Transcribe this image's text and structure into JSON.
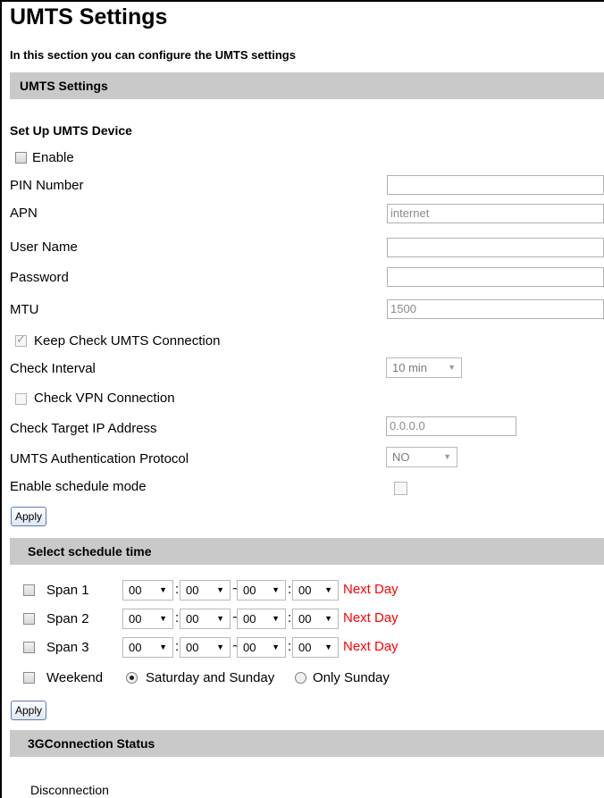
{
  "page": {
    "title": "UMTS Settings",
    "subtitle": "In this section you can configure the UMTS settings"
  },
  "umts_section": {
    "header": "UMTS Settings",
    "setup_label": "Set Up UMTS Device",
    "enable_label": "Enable",
    "enable_checked": false,
    "pin_label": "PIN Number",
    "pin_value": "",
    "apn_label": "APN",
    "apn_value": "internet",
    "username_label": "User Name",
    "username_value": "",
    "password_label": "Password",
    "password_value": "",
    "mtu_label": "MTU",
    "mtu_value": "1500",
    "keep_check_label": "Keep Check UMTS Connection",
    "keep_check_checked": true,
    "check_interval_label": "Check Interval",
    "check_interval_value": "10 min",
    "check_vpn_label": "Check VPN Connection",
    "check_vpn_checked": false,
    "target_ip_label": "Check Target IP Address",
    "target_ip_value": "0.0.0.0",
    "auth_protocol_label": "UMTS Authentication Protocol",
    "auth_protocol_value": "NO",
    "schedule_mode_label": "Enable schedule mode",
    "schedule_mode_checked": false,
    "apply_label": "Apply"
  },
  "schedule_section": {
    "header": "Select schedule time",
    "spans": [
      {
        "label": "Span 1",
        "start_hour": "00",
        "start_min": "00",
        "end_hour": "00",
        "end_min": "00",
        "next_day": "Next Day"
      },
      {
        "label": "Span 2",
        "start_hour": "00",
        "start_min": "00",
        "end_hour": "00",
        "end_min": "00",
        "next_day": "Next Day"
      },
      {
        "label": "Span 3",
        "start_hour": "00",
        "start_min": "00",
        "end_hour": "00",
        "end_min": "00",
        "next_day": "Next Day"
      }
    ],
    "separator_colon": ":",
    "separator_tilde": "~",
    "weekend_label": "Weekend",
    "radio_saturday_sunday": "Saturday and Sunday",
    "radio_only_sunday": "Only Sunday",
    "selected_weekend": "Saturday and Sunday",
    "apply_label": "Apply"
  },
  "status_section": {
    "header": "3GConnection Status",
    "status_text": "Disconnection"
  },
  "icons": {
    "dropdown_arrow": "▼"
  }
}
